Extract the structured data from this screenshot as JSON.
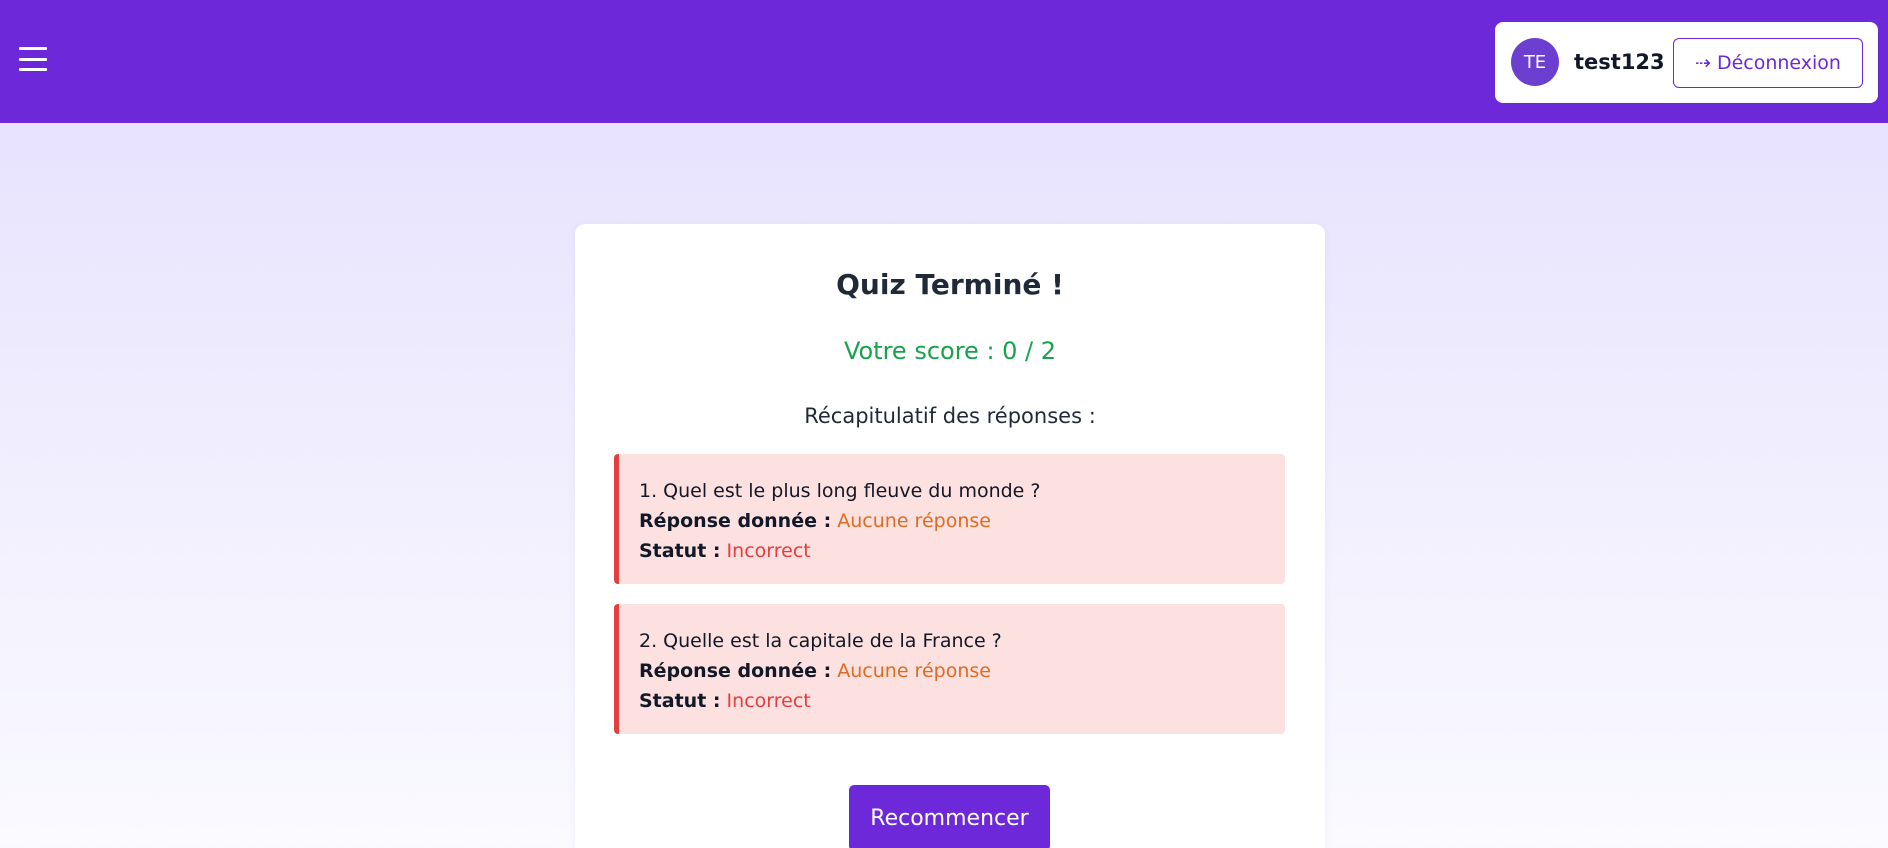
{
  "header": {
    "menu_icon": "hamburger-icon",
    "user": {
      "avatar_initials": "TE",
      "username": "test123"
    },
    "logout": {
      "icon": "arrow-right-icon",
      "icon_glyph": "⇢",
      "label": "Déconnexion"
    }
  },
  "quiz": {
    "title": "Quiz Terminé !",
    "score_text": "Votre score : 0 / 2",
    "recap_heading": "Récapitulatif des réponses :",
    "answer_label": "Réponse donnée :",
    "status_label": "Statut :",
    "answers": [
      {
        "question": "1. Quel est le plus long fleuve du monde ?",
        "given": "Aucune réponse",
        "status": "Incorrect"
      },
      {
        "question": "2. Quelle est la capitale de la France ?",
        "given": "Aucune réponse",
        "status": "Incorrect"
      }
    ],
    "restart_label": "Recommencer"
  },
  "colors": {
    "brand": "#6d28d9",
    "score": "#16a34a",
    "incorrect": "#e53e3e",
    "answer_given": "#dd6b20",
    "answer_bg": "#fde0e0"
  }
}
